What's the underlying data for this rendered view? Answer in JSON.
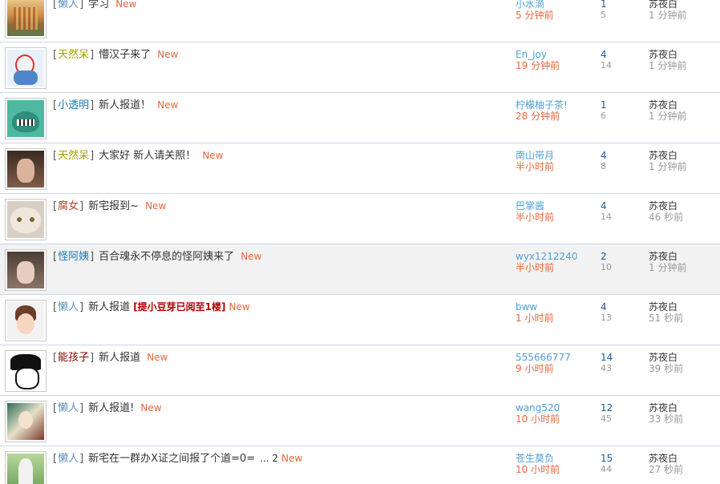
{
  "colors": {
    "category_default": "#5c8ec0",
    "category_tianran": "#a3a300",
    "category_funv": "#c0392b",
    "category_guaayi": "#1a7ab0",
    "category_nenghaizi": "#8b0000",
    "new_tag": "#e6683c",
    "author_name": "#4e9fd6",
    "author_time": "#e6683c",
    "reply_count": "#1a5c9a",
    "row_divider": "#c8d7e6",
    "row_highlight": "#f2f2f2"
  },
  "threads": [
    {
      "avatar_icon": "avatar-image",
      "category": "懒人",
      "category_color": "#5c8ec0",
      "subject": "学习",
      "new_label": "New",
      "note": "",
      "pages": "",
      "author": "小水滴",
      "post_time": "5 分钟前",
      "replies": "1",
      "views": "5",
      "last_poster": "苏夜白",
      "last_time": "1 分钟前",
      "highlighted": false
    },
    {
      "avatar_icon": "avatar-image",
      "category": "天然呆",
      "category_color": "#a3a300",
      "subject": "懵汉子来了",
      "new_label": "New",
      "note": "",
      "pages": "",
      "author": "En_joy",
      "post_time": "19 分钟前",
      "replies": "4",
      "views": "14",
      "last_poster": "苏夜白",
      "last_time": "1 分钟前",
      "highlighted": false
    },
    {
      "avatar_icon": "avatar-image",
      "category": "小透明",
      "category_color": "#1a7ab0",
      "subject": "新人报道！",
      "new_label": "New",
      "note": "",
      "pages": "",
      "author": "柠檬柚子茶!",
      "post_time": "28 分钟前",
      "replies": "1",
      "views": "6",
      "last_poster": "苏夜白",
      "last_time": "1 分钟前",
      "highlighted": false
    },
    {
      "avatar_icon": "avatar-image",
      "category": "天然呆",
      "category_color": "#a3a300",
      "subject": "大家好 新人请关照！",
      "new_label": "New",
      "note": "",
      "pages": "",
      "author": "南山带月",
      "post_time": "半小时前",
      "replies": "4",
      "views": "8",
      "last_poster": "苏夜白",
      "last_time": "1 分钟前",
      "highlighted": false
    },
    {
      "avatar_icon": "avatar-image",
      "category": "腐女",
      "category_color": "#c0392b",
      "subject": "新宅报到~",
      "new_label": "New",
      "note": "",
      "pages": "",
      "author": "巴掌酱",
      "post_time": "半小时前",
      "replies": "4",
      "views": "14",
      "last_poster": "苏夜白",
      "last_time": "46 秒前",
      "highlighted": false
    },
    {
      "avatar_icon": "avatar-image",
      "category": "怪阿姨",
      "category_color": "#1a7ab0",
      "subject": "百合魂永不停息的怪阿姨来了",
      "new_label": "New",
      "note": "",
      "pages": "",
      "author": "wyx1212240",
      "post_time": "半小时前",
      "replies": "2",
      "views": "10",
      "last_poster": "苏夜白",
      "last_time": "1 分钟前",
      "highlighted": true
    },
    {
      "avatar_icon": "avatar-image",
      "category": "懒人",
      "category_color": "#5c8ec0",
      "subject": "新人报道",
      "new_label": "New",
      "note": "[提小豆芽已阅至1楼]",
      "pages": "",
      "author": "bww",
      "post_time": "1 小时前",
      "replies": "4",
      "views": "13",
      "last_poster": "苏夜白",
      "last_time": "51 秒前",
      "highlighted": false
    },
    {
      "avatar_icon": "avatar-image",
      "category": "能孩子",
      "category_color": "#8b0000",
      "subject": "新人报道",
      "new_label": "New",
      "note": "",
      "pages": "",
      "author": "555666777",
      "post_time": "9 小时前",
      "replies": "14",
      "views": "43",
      "last_poster": "苏夜白",
      "last_time": "39 秒前",
      "highlighted": false
    },
    {
      "avatar_icon": "avatar-image",
      "category": "懒人",
      "category_color": "#5c8ec0",
      "subject": "新人报道!",
      "new_label": "New",
      "note": "",
      "pages": "",
      "author": "wang520",
      "post_time": "10 小时前",
      "replies": "12",
      "views": "45",
      "last_poster": "苏夜白",
      "last_time": "33 秒前",
      "highlighted": false
    },
    {
      "avatar_icon": "avatar-image",
      "category": "懒人",
      "category_color": "#5c8ec0",
      "subject": "新宅在一群办X证之间报了个道=0=",
      "new_label": "New",
      "note": "",
      "pages": "... 2",
      "author": "苍生莫负",
      "post_time": "10 小时前",
      "replies": "15",
      "views": "44",
      "last_poster": "苏夜白",
      "last_time": "27 秒前",
      "highlighted": false
    }
  ]
}
